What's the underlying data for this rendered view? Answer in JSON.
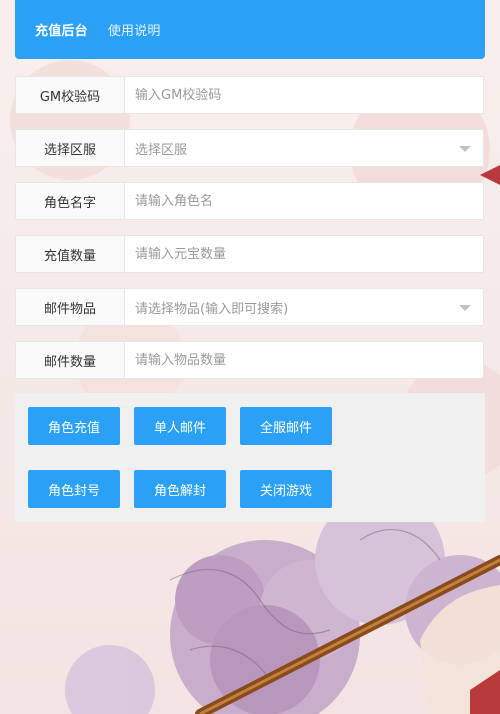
{
  "nav": {
    "items": [
      {
        "label": "充值后台",
        "active": true
      },
      {
        "label": "使用说明",
        "active": false
      }
    ]
  },
  "form": {
    "fields": [
      {
        "label": "GM校验码",
        "type": "input",
        "placeholder": "输入GM校验码",
        "value": ""
      },
      {
        "label": "选择区服",
        "type": "select",
        "placeholder": "选择区服",
        "value": ""
      },
      {
        "label": "角色名字",
        "type": "input",
        "placeholder": "请输入角色名",
        "value": ""
      },
      {
        "label": "充值数量",
        "type": "input",
        "placeholder": "请输入元宝数量",
        "value": ""
      },
      {
        "label": "邮件物品",
        "type": "select",
        "placeholder": "请选择物品(输入即可搜索)",
        "value": ""
      },
      {
        "label": "邮件数量",
        "type": "input",
        "placeholder": "请输入物品数量",
        "value": ""
      }
    ]
  },
  "actions": {
    "row1": [
      "角色充值",
      "单人邮件",
      "全服邮件"
    ],
    "row2": [
      "角色封号",
      "角色解封",
      "关闭游戏"
    ]
  },
  "colors": {
    "primary": "#2aa0f6",
    "panel": "#f0f0f0",
    "label_bg": "#fafafa",
    "border": "#e6e6e6"
  }
}
